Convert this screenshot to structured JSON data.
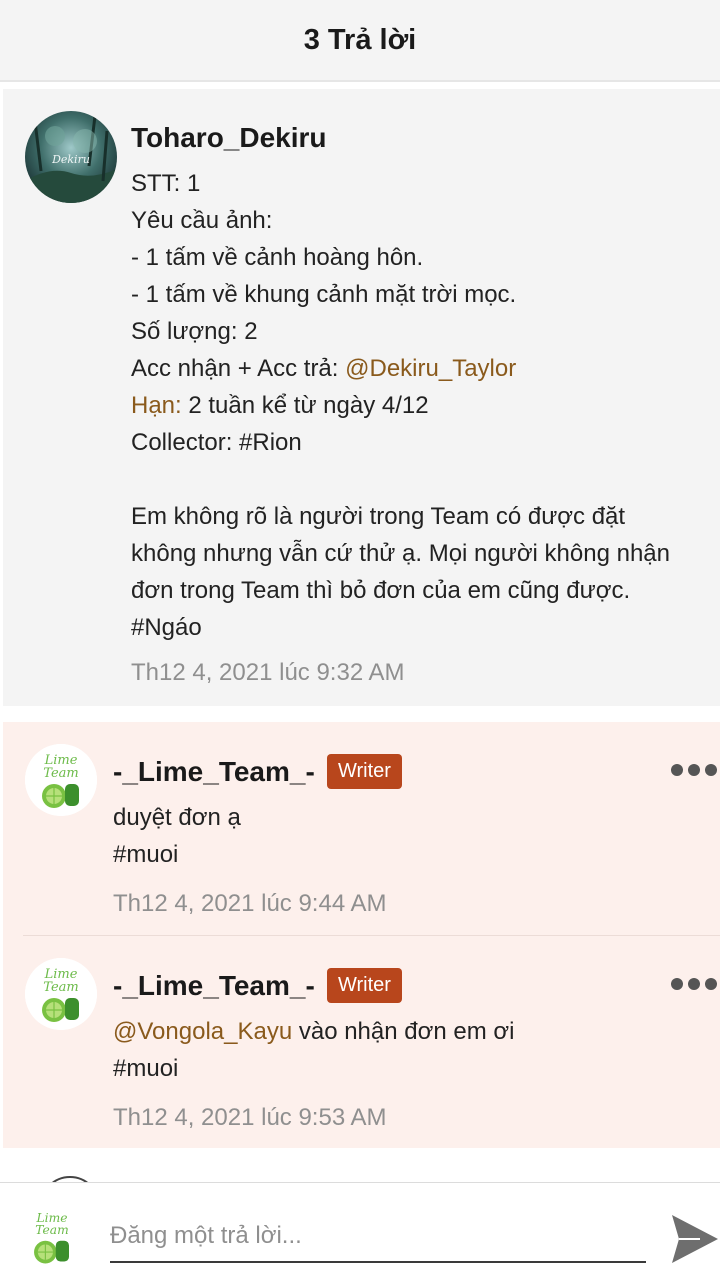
{
  "header": {
    "title": "3 Trả lời"
  },
  "post": {
    "author": "Toharo_Dekiru",
    "avatar_signature": "Dekiru",
    "lines": [
      {
        "text": "STT:  1"
      },
      {
        "text": "Yêu cầu ảnh:"
      },
      {
        "text": "- 1 tấm về cảnh hoàng hôn."
      },
      {
        "text": "- 1 tấm về khung cảnh mặt trời mọc."
      },
      {
        "text": "Số lượng: 2"
      },
      {
        "prefix": "Acc nhận + Acc trả: ",
        "mention": "@Dekiru_Taylor"
      },
      {
        "label": "Hạn:",
        "rest": " 2 tuần kể từ ngày 4/12"
      },
      {
        "text": "Collector: #Rion"
      },
      {
        "text": ""
      },
      {
        "text": "Em không rõ là người trong Team có được đặt"
      },
      {
        "text": "không nhưng vẫn cứ thử ạ. Mọi người không nhận"
      },
      {
        "text": "đơn trong Team thì bỏ đơn của em cũng được."
      },
      {
        "text": "#Ngáo"
      }
    ],
    "timestamp": "Th12 4, 2021 lúc 9:32 AM"
  },
  "replies": [
    {
      "author": "-_Lime_Team_-",
      "badge": "Writer",
      "avatar_text": [
        "Lime",
        "Team"
      ],
      "line1": "duyệt đơn ạ",
      "line2": "#muoi",
      "timestamp": "Th12 4, 2021 lúc 9:44 AM"
    },
    {
      "author": "-_Lime_Team_-",
      "badge": "Writer",
      "avatar_text": [
        "Lime",
        "Team"
      ],
      "mention": "@Vongola_Kayu",
      "line1_rest": " vào nhận đơn em ơi",
      "line2": "#muoi",
      "timestamp": "Th12 4, 2021 lúc 9:53 AM"
    }
  ],
  "composer": {
    "placeholder": "Đăng một trả lời...",
    "avatar_text": [
      "Lime",
      "Team"
    ]
  },
  "colors": {
    "mention": "#8a5a1c",
    "badge_bg": "#b8461c",
    "reply_bg": "#fdf0ec",
    "post_bg": "#f4f4f4"
  },
  "icons": [
    "more-options-icon",
    "send-icon",
    "lime-team-logo"
  ]
}
